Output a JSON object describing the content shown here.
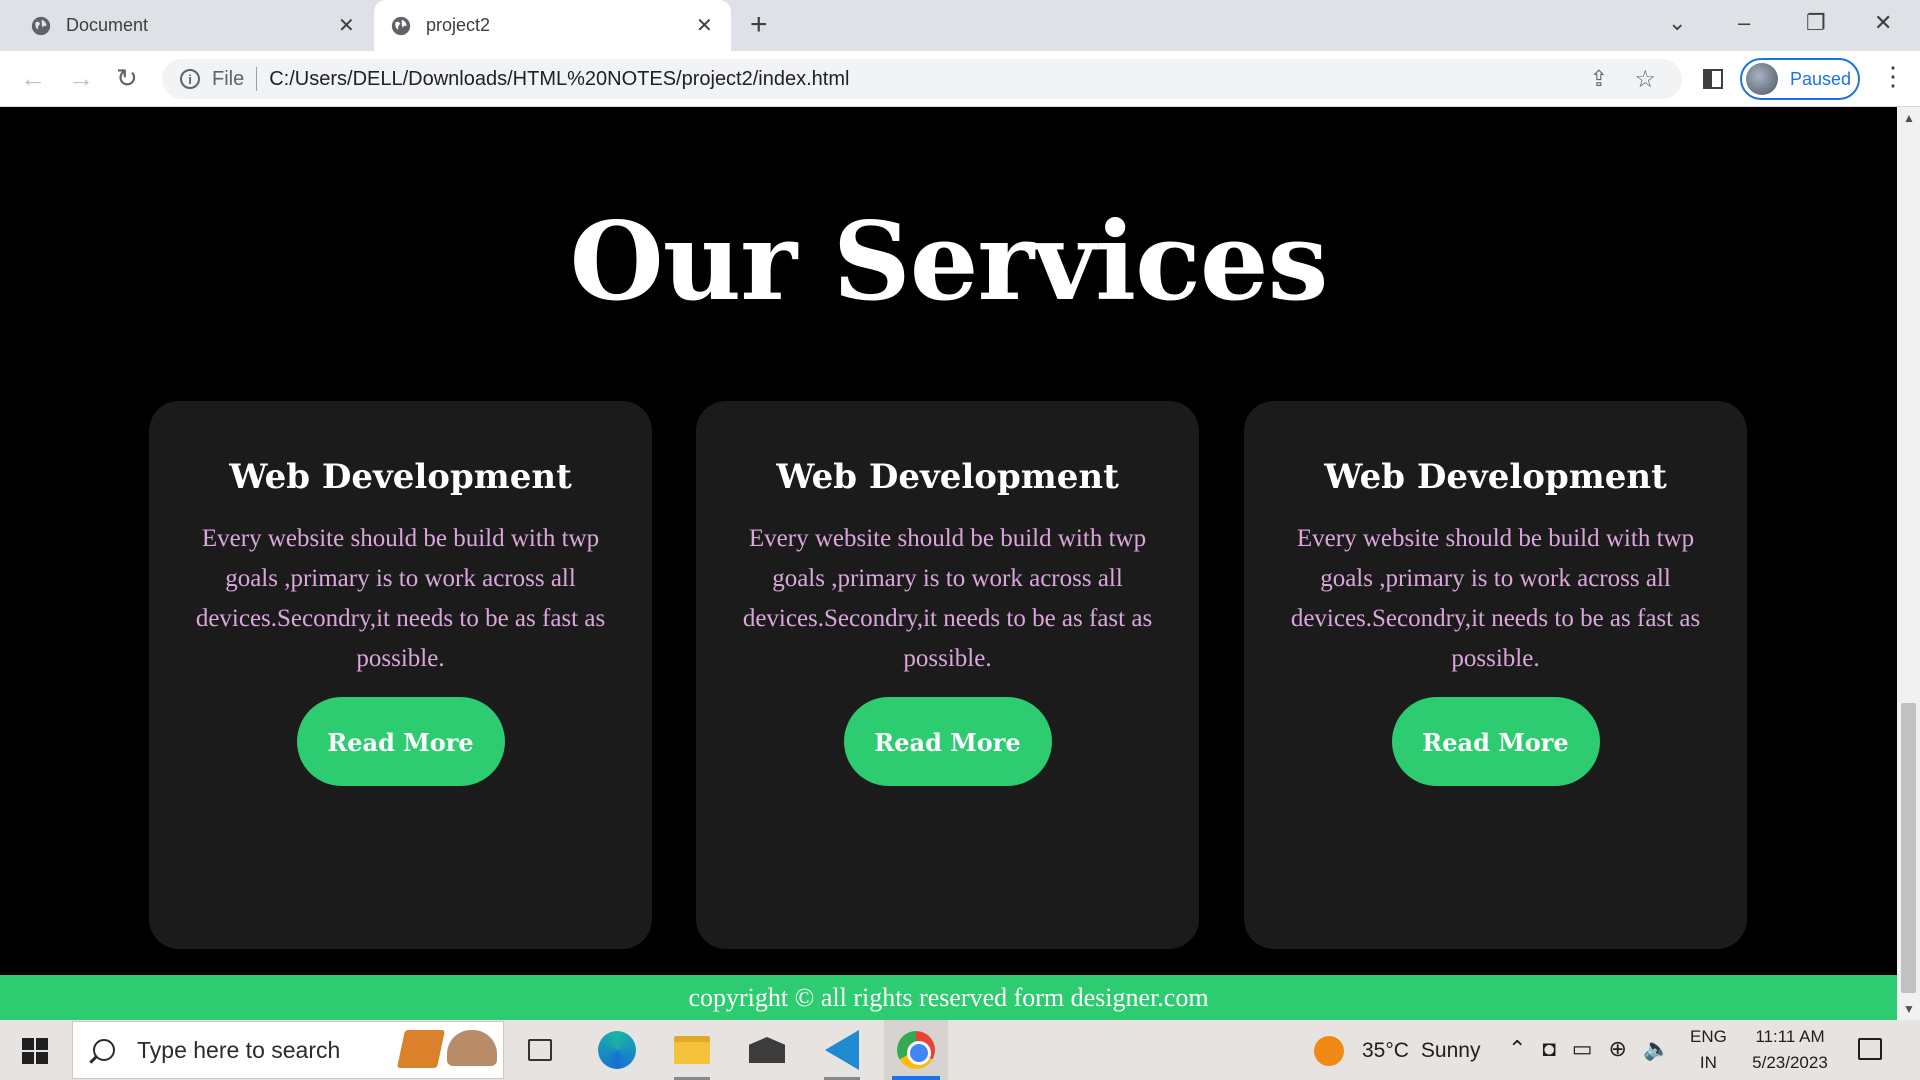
{
  "browser": {
    "tabs": [
      {
        "title": "Document",
        "active": false
      },
      {
        "title": "project2",
        "active": true
      }
    ],
    "address": {
      "scheme_label": "File",
      "url": "C:/Users/DELL/Downloads/HTML%20NOTES/project2/index.html"
    },
    "profile_label": "Paused"
  },
  "page": {
    "title": "Our Services",
    "cards": [
      {
        "heading": "Web Development",
        "body": "Every website should be build with twp goals ,primary is to work across all devices.Secondry,it needs to be as fast as possible.",
        "button": "Read More"
      },
      {
        "heading": "Web Development",
        "body": "Every website should be build with twp goals ,primary is to work across all devices.Secondry,it needs to be as fast as possible.",
        "button": "Read More"
      },
      {
        "heading": "Web Development",
        "body": "Every website should be build with twp goals ,primary is to work across all devices.Secondry,it needs to be as fast as possible.",
        "button": "Read More"
      }
    ],
    "footer": "copyright © all rights reserved form designer.com"
  },
  "colors": {
    "page_bg": "#000000",
    "card_bg": "#1b1b1b",
    "accent_green": "#2ecc71",
    "body_text_pink": "#dba6dc"
  },
  "taskbar": {
    "search_placeholder": "Type here to search",
    "apps": [
      "task-view-icon",
      "edge-icon",
      "file-explorer-icon",
      "mail-icon",
      "vscode-icon",
      "chrome-icon"
    ],
    "weather": {
      "temp": "35°C",
      "condition": "Sunny"
    },
    "language": {
      "line1": "ENG",
      "line2": "IN"
    },
    "clock": {
      "time": "11:11 AM",
      "date": "5/23/2023"
    }
  }
}
